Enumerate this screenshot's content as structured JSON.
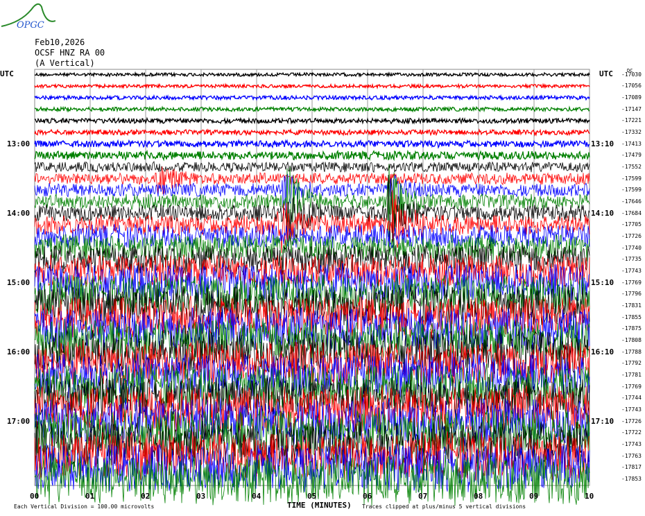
{
  "logo": {
    "text": "OPGC"
  },
  "header": {
    "date": "Feb10,2026",
    "station": "OCSF HNZ RA 00",
    "component": "(A Vertical)"
  },
  "utc_left": "UTC",
  "utc_right": "UTC",
  "dc_label": "DC",
  "chart_data": {
    "type": "line",
    "title": "OCSF HNZ RA 00 (A Vertical) Feb10,2026",
    "xlabel": "TIME (MINUTES)",
    "xlim": [
      0,
      10
    ],
    "x_ticks": [
      "00",
      "01",
      "02",
      "03",
      "04",
      "05",
      "06",
      "07",
      "08",
      "09",
      "10"
    ],
    "left_time_labels": [
      {
        "trace": 6,
        "label": "13:00"
      },
      {
        "trace": 12,
        "label": "14:00"
      },
      {
        "trace": 18,
        "label": "15:00"
      },
      {
        "trace": 24,
        "label": "16:00"
      },
      {
        "trace": 30,
        "label": "17:00"
      }
    ],
    "right_time_labels": [
      {
        "trace": 6,
        "label": "13:10"
      },
      {
        "trace": 12,
        "label": "14:10"
      },
      {
        "trace": 18,
        "label": "15:10"
      },
      {
        "trace": 24,
        "label": "16:10"
      },
      {
        "trace": 30,
        "label": "17:10"
      }
    ],
    "trace_colors": [
      "#000000",
      "#ff0000",
      "#0000ff",
      "#008000"
    ],
    "trace_dc_offsets": [
      "-17030",
      "-17056",
      "-17089",
      "-17147",
      "-17221",
      "-17332",
      "-17413",
      "-17479",
      "-17552",
      "-17599",
      "-17599",
      "-17646",
      "-17684",
      "-17705",
      "-17726",
      "-17740",
      "-17735",
      "-17743",
      "-17769",
      "-17796",
      "-17831",
      "-17855",
      "-17875",
      "-17808",
      "-17788",
      "-17792",
      "-17781",
      "-17769",
      "-17744",
      "-17743",
      "-17726",
      "-17722",
      "-17743",
      "-17763",
      "-17817",
      "-17853"
    ],
    "trace_amplitude_divisions": [
      0.1,
      0.1,
      0.12,
      0.12,
      0.15,
      0.15,
      0.2,
      0.25,
      0.3,
      0.35,
      0.4,
      0.45,
      0.5,
      0.6,
      0.7,
      0.8,
      0.9,
      1.0,
      1.1,
      1.2,
      1.2,
      1.2,
      1.3,
      1.3,
      1.3,
      1.3,
      1.3,
      1.3,
      1.3,
      1.4,
      1.4,
      1.4,
      1.4,
      1.4,
      1.4,
      1.5
    ],
    "events": [
      {
        "trace": 9,
        "minute": 2.25,
        "amp": 1.2
      },
      {
        "trace": 10,
        "minute": 4.5,
        "amp": 1.5
      },
      {
        "trace": 11,
        "minute": 4.6,
        "amp": 2.5
      },
      {
        "trace": 12,
        "minute": 4.6,
        "amp": 2.5
      },
      {
        "trace": 13,
        "minute": 4.4,
        "amp": 2
      },
      {
        "trace": 10,
        "minute": 6.4,
        "amp": 1.5
      },
      {
        "trace": 11,
        "minute": 6.4,
        "amp": 2.5
      },
      {
        "trace": 12,
        "minute": 6.4,
        "amp": 2.8
      },
      {
        "trace": 13,
        "minute": 6.5,
        "amp": 2
      }
    ],
    "clip_divisions": 5
  },
  "footer": {
    "scale": "Each Vertical Division =  100.00 microvolts",
    "clip_note": "Traces clipped at plus/minus 5 vertical divisions"
  }
}
